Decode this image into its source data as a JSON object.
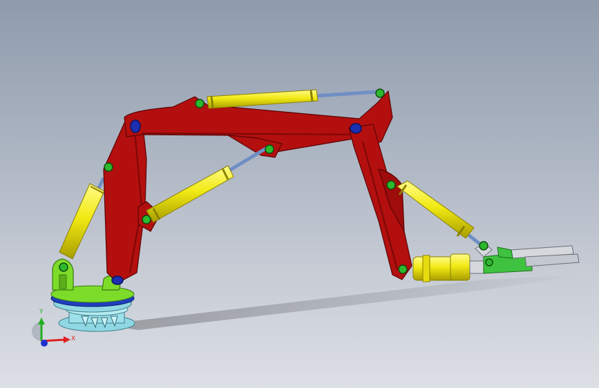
{
  "viewport": {
    "background_top": "#8f9bac",
    "background_bottom": "#dcdfe5"
  },
  "model": {
    "description_icon": "robotic-arm-assembly",
    "colors": {
      "frame_red": "#b30f0f",
      "frame_red_dark": "#7a0707",
      "cylinder_yellow": "#f2ea14",
      "cylinder_yellow_dark": "#a89e00",
      "rod_blue": "#6f8fc4",
      "pin_green": "#2db82d",
      "pin_blue": "#1b2fb0",
      "base_green": "#7ddc2a",
      "base_cyan": "#8fd7e3",
      "base_blue": "#1f3fbf",
      "gripper_green": "#3fc23f",
      "gripper_silver": "#d5d9de"
    }
  },
  "triad": {
    "x_label": "X",
    "y_label": "Y",
    "x_color": "#e02020",
    "y_color": "#20b020",
    "z_color": "#2030d0"
  }
}
